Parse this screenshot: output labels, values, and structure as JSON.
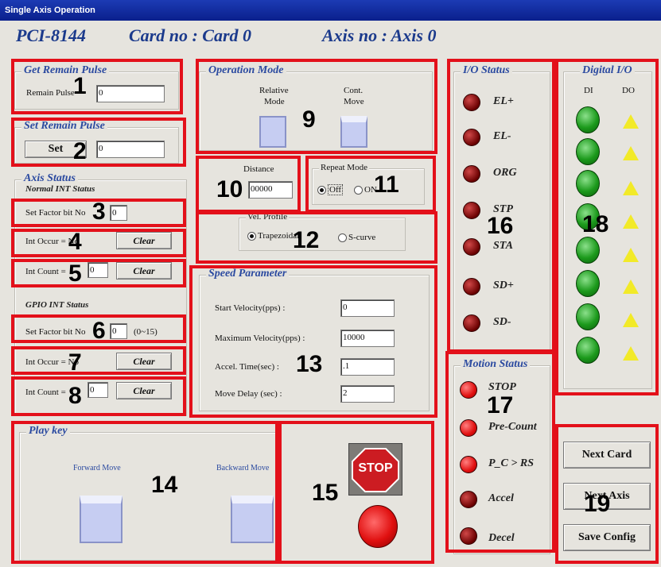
{
  "window": {
    "title": "Single Axis Operation"
  },
  "header": {
    "card_type": "PCI-8144",
    "card_no": "Card no : Card  0",
    "axis_no": "Axis no : Axis  0"
  },
  "get_remain_pulse": {
    "title": "Get Remain Pulse",
    "label": "Remain Pulse",
    "value": "0"
  },
  "set_remain_pulse": {
    "title": "Set Remain Pulse",
    "button": "Set",
    "value": "0"
  },
  "axis_status": {
    "title": "Axis Status",
    "normal_int": {
      "title": "Normal INT Status",
      "factor_label": "Set Factor bit No",
      "factor_value": "0",
      "occur_label": "Int Occur = No",
      "count_label": "Int Count =",
      "count_value": "0",
      "clear": "Clear"
    },
    "gpio_int": {
      "title": "GPIO INT Status",
      "factor_label": "Set Factor bit No",
      "factor_value": "0",
      "range": "(0~15)",
      "occur_label": "Int Occur = No",
      "count_label": "Int Count =",
      "count_value": "0",
      "clear": "Clear"
    }
  },
  "operation_mode": {
    "title": "Operation Mode",
    "relative_l1": "Relative",
    "relative_l2": "Mode",
    "cont_l1": "Cont.",
    "cont_l2": "Move"
  },
  "distance": {
    "label": "Distance",
    "value": "00000"
  },
  "repeat_mode": {
    "label": "Repeat Mode",
    "off": "Off",
    "on": "ON"
  },
  "vel_profile": {
    "label": "Vel. Profile",
    "trap": "Trapezoidal",
    "scurve": "S-curve"
  },
  "speed": {
    "title": "Speed Parameter",
    "start_label": "Start Velocity(pps) :",
    "start_value": "0",
    "max_label": "Maximum  Velocity(pps) :",
    "max_value": "10000",
    "accel_label": "Accel. Time(sec) :",
    "accel_value": ".1",
    "delay_label": "Move Delay (sec) :",
    "delay_value": "2"
  },
  "play_key": {
    "title": "Play key",
    "forward": "Forward Move",
    "backward": "Backward Move"
  },
  "stop": {
    "label": "STOP"
  },
  "io_status": {
    "title": "I/O Status",
    "items": [
      "EL+",
      "EL-",
      "ORG",
      "STP",
      "STA",
      "SD+",
      "SD-"
    ]
  },
  "digital_io": {
    "title": "Digital I/O",
    "di": "DI",
    "do": "DO"
  },
  "motion_status": {
    "title": "Motion Status",
    "items": [
      "STOP",
      "Pre-Count",
      "P_C > RS",
      "Accel",
      "Decel"
    ]
  },
  "buttons": {
    "next_card": "Next Card",
    "next_axis": "Next Axis",
    "save_config": "Save Config"
  },
  "annotations": [
    "1",
    "2",
    "3",
    "4",
    "5",
    "6",
    "7",
    "8",
    "9",
    "10",
    "11",
    "12",
    "13",
    "14",
    "15",
    "16",
    "17",
    "18",
    "19"
  ],
  "colors": {
    "annotation_box": "#e3101a",
    "title_bar": "#0a1f8c",
    "header_text": "#1b3a8c"
  }
}
